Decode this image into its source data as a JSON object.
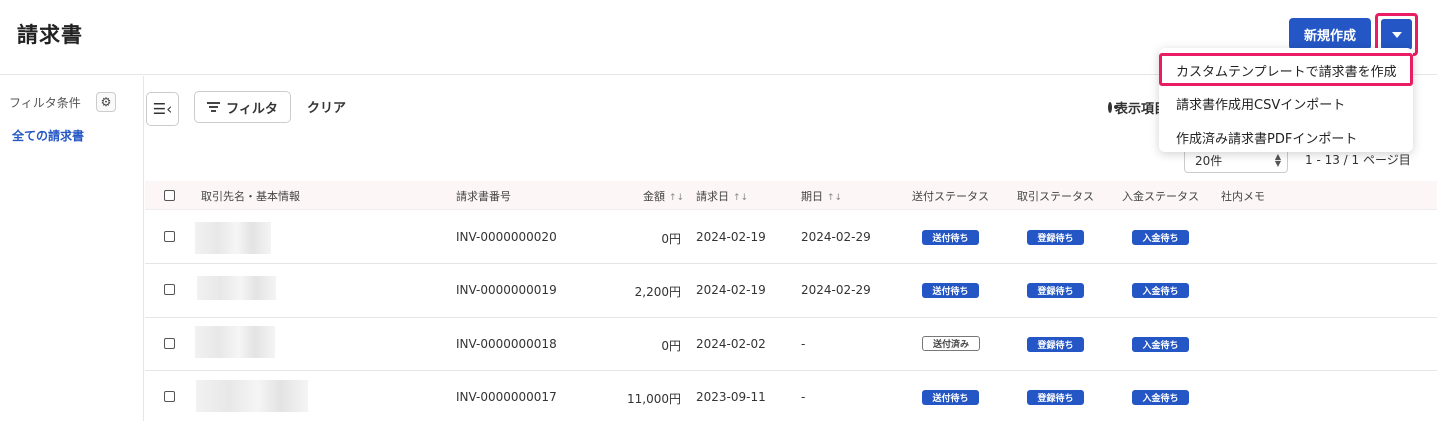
{
  "header": {
    "title": "請求書",
    "new_label": "新規作成"
  },
  "menu": {
    "items": [
      "カスタムテンプレートで請求書を作成",
      "請求書作成用CSVインポート",
      "作成済み請求書PDFインポート"
    ]
  },
  "sidebar": {
    "filter_label": "フィルタ条件",
    "all_label": "全ての請求書"
  },
  "toolbar": {
    "filter_label": "フィルタ",
    "clear_label": "クリア",
    "display_label": "表示項目"
  },
  "pagination": {
    "size_value": "20件",
    "info": "1 - 13 / 1 ページ目"
  },
  "table": {
    "headers": {
      "client": "取引先名・基本情報",
      "number": "請求書番号",
      "amount": "金額",
      "date": "請求日",
      "due": "期日",
      "send_status": "送付ステータス",
      "deal_status": "取引ステータス",
      "pay_status": "入金ステータス",
      "memo": "社内メモ"
    },
    "rows": [
      {
        "number": "INV-0000000020",
        "amount": "0円",
        "date": "2024-02-19",
        "due": "2024-02-29",
        "send": "送付待ち",
        "deal": "登録待ち",
        "pay": "入金待ち"
      },
      {
        "number": "INV-0000000019",
        "amount": "2,200円",
        "date": "2024-02-19",
        "due": "2024-02-29",
        "send": "送付待ち",
        "deal": "登録待ち",
        "pay": "入金待ち"
      },
      {
        "number": "INV-0000000018",
        "amount": "0円",
        "date": "2024-02-02",
        "due": "-",
        "send": "送付済み",
        "deal": "登録待ち",
        "pay": "入金待ち"
      },
      {
        "number": "INV-0000000017",
        "amount": "11,000円",
        "date": "2023-09-11",
        "due": "-",
        "send": "送付待ち",
        "deal": "登録待ち",
        "pay": "入金待ち"
      }
    ]
  },
  "colors": {
    "primary": "#2457c5",
    "highlight": "#ea1c63"
  }
}
